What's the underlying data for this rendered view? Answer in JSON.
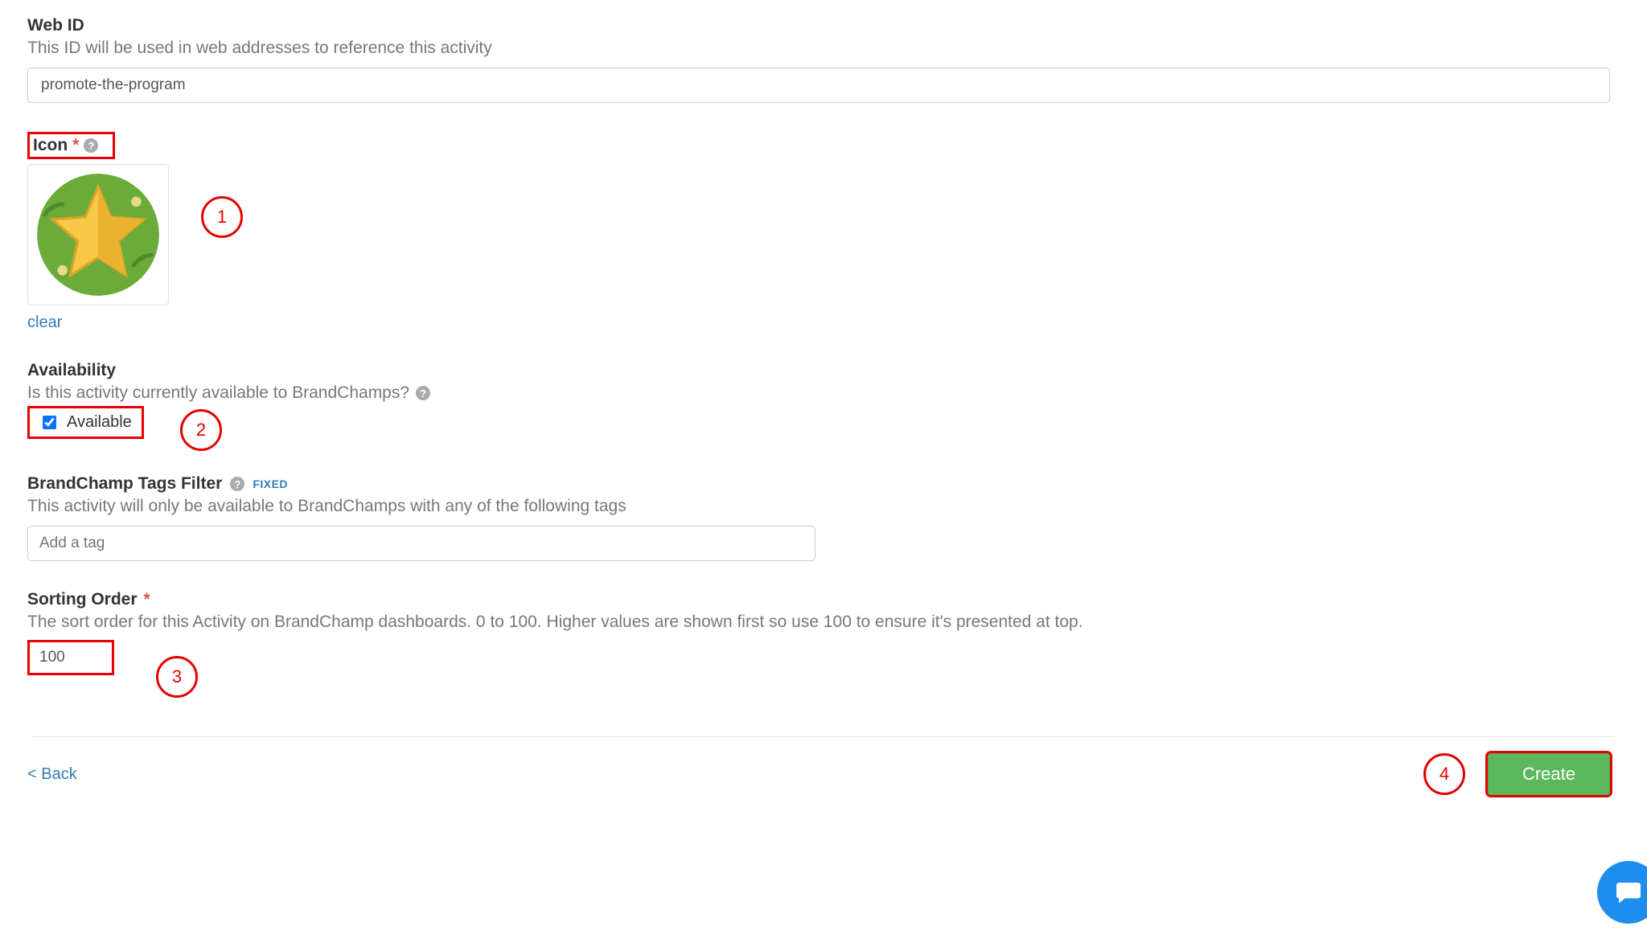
{
  "webid": {
    "label": "Web ID",
    "sublabel": "This ID will be used in web addresses to reference this activity",
    "value": "promote-the-program"
  },
  "icon": {
    "label": "Icon",
    "required_marker": "*",
    "clear": "clear"
  },
  "availability": {
    "label": "Availability",
    "sublabel": "Is this activity currently available to BrandChamps?",
    "checkbox_label": "Available",
    "checked": true
  },
  "tags": {
    "label": "BrandChamp Tags Filter",
    "badge": "FIXED",
    "sublabel": "This activity will only be available to BrandChamps with any of the following tags",
    "placeholder": "Add a tag"
  },
  "sort": {
    "label": "Sorting Order",
    "required_marker": "*",
    "sublabel": "The sort order for this Activity on BrandChamp dashboards. 0 to 100. Higher values are shown first so use 100 to ensure it's presented at top.",
    "value": "100"
  },
  "footer": {
    "back": "< Back",
    "create": "Create"
  },
  "callouts": {
    "c1": "1",
    "c2": "2",
    "c3": "3",
    "c4": "4"
  }
}
